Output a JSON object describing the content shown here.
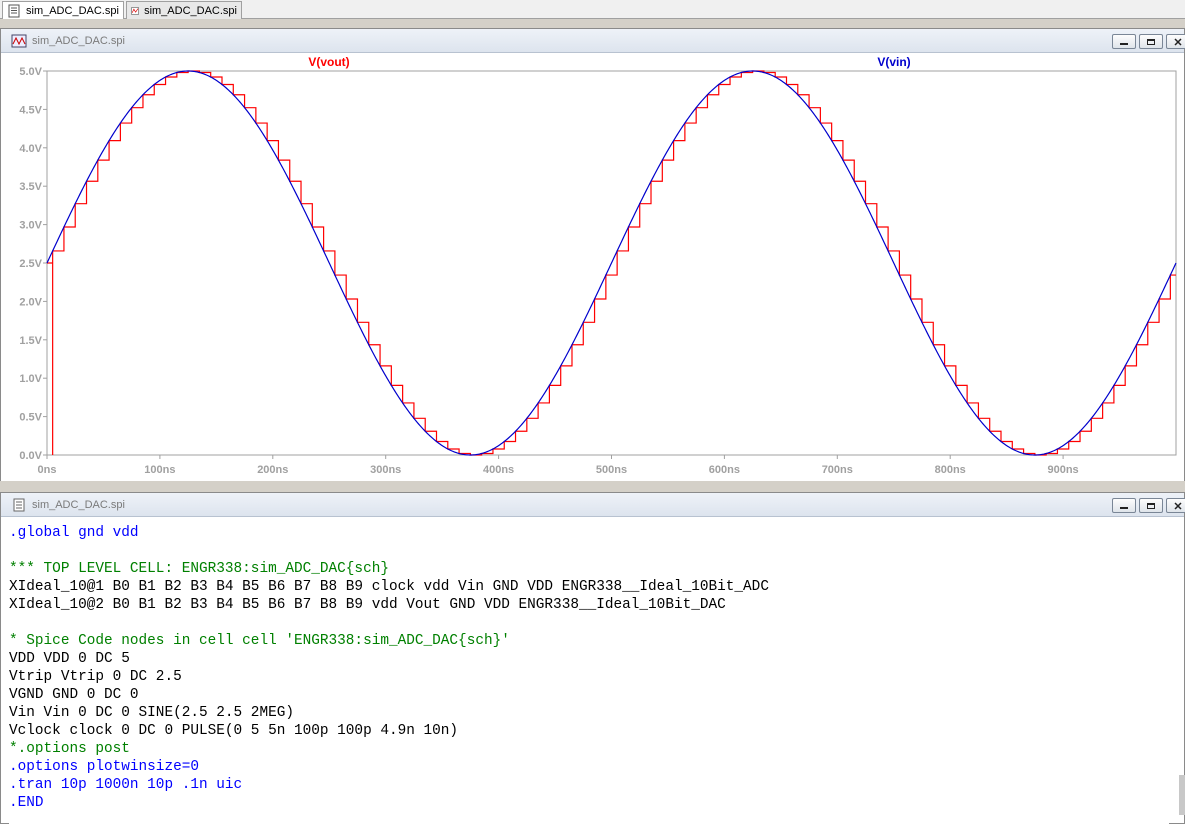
{
  "tabs": [
    {
      "label": "sim_ADC_DAC.spi",
      "icon": "document-icon",
      "active": true
    },
    {
      "label": "sim_ADC_DAC.spi",
      "icon": "waveform-icon",
      "active": false
    }
  ],
  "plot_window": {
    "title": "sim_ADC_DAC.spi",
    "icon": "waveform-icon"
  },
  "netlist_window": {
    "title": "sim_ADC_DAC.spi",
    "lines": [
      {
        "text": ".global gnd vdd",
        "color": "blue"
      },
      {
        "text": "",
        "color": "black"
      },
      {
        "text": "*** TOP LEVEL CELL: ENGR338:sim_ADC_DAC{sch}",
        "color": "green"
      },
      {
        "text": "XIdeal_10@1 B0 B1 B2 B3 B4 B5 B6 B7 B8 B9 clock vdd Vin GND VDD ENGR338__Ideal_10Bit_ADC",
        "color": "black"
      },
      {
        "text": "XIdeal_10@2 B0 B1 B2 B3 B4 B5 B6 B7 B8 B9 vdd Vout GND VDD ENGR338__Ideal_10Bit_DAC",
        "color": "black"
      },
      {
        "text": "",
        "color": "black"
      },
      {
        "text": "* Spice Code nodes in cell cell 'ENGR338:sim_ADC_DAC{sch}'",
        "color": "green"
      },
      {
        "text": "VDD VDD 0 DC 5",
        "color": "black"
      },
      {
        "text": "Vtrip Vtrip 0 DC 2.5",
        "color": "black"
      },
      {
        "text": "VGND GND 0 DC 0",
        "color": "black"
      },
      {
        "text": "Vin Vin 0 DC 0 SINE(2.5 2.5 2MEG)",
        "color": "black"
      },
      {
        "text": "Vclock clock 0 DC 0 PULSE(0 5 5n 100p 100p 4.9n 10n)",
        "color": "black"
      },
      {
        "text": "*.options post",
        "color": "green"
      },
      {
        "text": ".options plotwinsize=0",
        "color": "blue"
      },
      {
        "text": ".tran 10p 1000n 10p .1n uic",
        "color": "blue"
      },
      {
        "text": ".END",
        "color": "blue"
      }
    ]
  },
  "chart_data": {
    "type": "line",
    "series": [
      {
        "name": "V(vout)",
        "color": "#ff0000",
        "kind": "staircase",
        "offset": 2.5,
        "amplitude": 2.5,
        "period_ns": 500,
        "step_ns": 10,
        "start_ns": 5
      },
      {
        "name": "V(vin)",
        "color": "#0000cc",
        "kind": "sine",
        "offset": 2.5,
        "amplitude": 2.5,
        "period_ns": 500
      }
    ],
    "x_ticks": [
      "0ns",
      "100ns",
      "200ns",
      "300ns",
      "400ns",
      "500ns",
      "600ns",
      "700ns",
      "800ns",
      "900ns"
    ],
    "x_tick_values": [
      0,
      100,
      200,
      300,
      400,
      500,
      600,
      700,
      800,
      900
    ],
    "y_ticks": [
      "0.0V",
      "0.5V",
      "1.0V",
      "1.5V",
      "2.0V",
      "2.5V",
      "3.0V",
      "3.5V",
      "4.0V",
      "4.5V",
      "5.0V"
    ],
    "y_tick_values": [
      0,
      0.5,
      1.0,
      1.5,
      2.0,
      2.5,
      3.0,
      3.5,
      4.0,
      4.5,
      5.0
    ],
    "xlim": [
      0,
      1000
    ],
    "ylim": [
      0,
      5
    ],
    "grid": false,
    "tick_label_color": "#a0a0a0",
    "axis_color": "#a0a0a0"
  }
}
